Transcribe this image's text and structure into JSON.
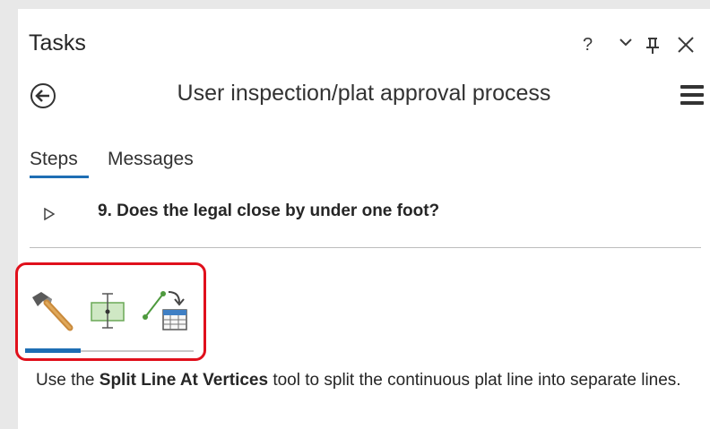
{
  "pane": {
    "title": "Tasks",
    "controls": {
      "help": "?",
      "options": "⌄",
      "pin": "⊥",
      "close": "✕"
    }
  },
  "task": {
    "name": "User inspection/plat approval process",
    "back_icon": "back-arrow-icon",
    "menu_icon": "hamburger-menu-icon"
  },
  "tabs": [
    {
      "label": "Steps",
      "active": true
    },
    {
      "label": "Messages",
      "active": false
    }
  ],
  "step": {
    "title": "9.  Does the legal close by under one foot?",
    "expander_icon": "expand-triangle-icon"
  },
  "tools": {
    "items": [
      {
        "icon": "hammer-icon",
        "active": true
      },
      {
        "icon": "split-line-at-vertices-icon",
        "active": false
      },
      {
        "icon": "line-to-table-icon",
        "active": false
      }
    ],
    "progress": 0.33,
    "highlight_color": "#e0101c"
  },
  "instructions": {
    "prefix": "Use the ",
    "tool_name": "Split Line At Vertices",
    "suffix": " tool to split the continuous plat line into separate lines."
  },
  "colors": {
    "accent": "#1e6eb4",
    "highlight": "#e0101c"
  }
}
